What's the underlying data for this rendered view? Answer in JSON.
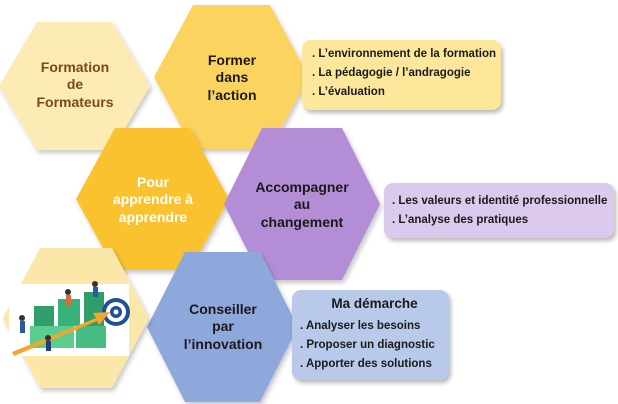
{
  "colors": {
    "hex_cream": "#fdebb5",
    "hex_gold": "#fbd461",
    "hex_amber": "#f9c22e",
    "hex_purple": "#b38dd6",
    "hex_blue": "#8fa8dc",
    "hex_image_bg": "#fbe7a8",
    "panel_yellow": "#fde79b",
    "panel_lavender": "#dcc9ee",
    "panel_blue": "#b8c9ea",
    "text_dark_brown": "#7a4a14",
    "text_dark": "#1a1a1a"
  },
  "hexagons": {
    "formation_formateurs": "Formation\nde\nFormateurs",
    "former_action": "Former\ndans\nl’action",
    "apprendre": "Pour\napprendre à\napprendre",
    "accompagner": "Accompagner\nau\nchangement",
    "conseiller": "Conseiller\npar\nl’innovation",
    "illustration_icon": "teamwork-growth-illustration"
  },
  "panels": {
    "action": {
      "items": [
        ". L’environnement de la formation",
        ". La pédagogie / l’andragogie",
        ". L’évaluation"
      ]
    },
    "changement": {
      "items": [
        ". Les valeurs et identité professionnelle",
        ". L’analyse des pratiques"
      ]
    },
    "demarche": {
      "title": "Ma démarche",
      "items": [
        ". Analyser les besoins",
        ". Proposer un diagnostic",
        ". Apporter des solutions"
      ]
    }
  }
}
